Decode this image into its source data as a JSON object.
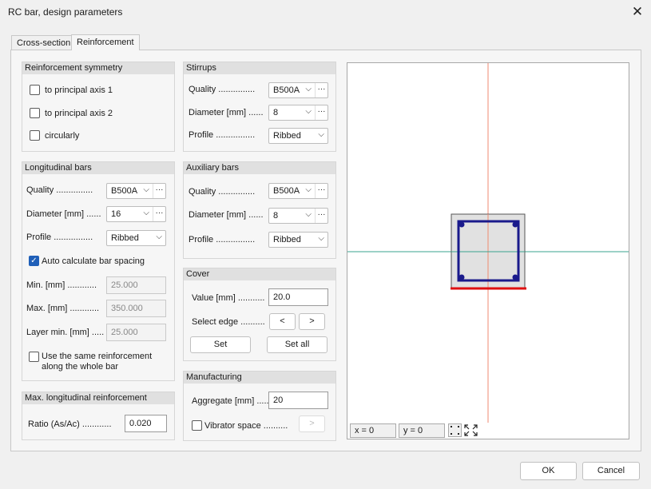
{
  "window": {
    "title": "RC bar, design parameters",
    "close_glyph": "✕"
  },
  "tabs": [
    {
      "label": "Cross-section"
    },
    {
      "label": "Reinforcement"
    }
  ],
  "symmetry": {
    "header": "Reinforcement symmetry",
    "options": [
      {
        "label": "to principal axis 1",
        "checked": false
      },
      {
        "label": "to principal axis 2",
        "checked": false
      },
      {
        "label": "circularly",
        "checked": false
      }
    ]
  },
  "longitudinal": {
    "header": "Longitudinal bars",
    "quality_label": "Quality ...............",
    "quality_value": "B500A",
    "diameter_label": "Diameter [mm] ......",
    "diameter_value": "16",
    "profile_label": "Profile ................",
    "profile_value": "Ribbed",
    "auto_label": "Auto calculate bar spacing",
    "auto_checked": true,
    "min_label": "Min. [mm] ............",
    "min_value": "25.000",
    "max_label": "Max. [mm] ............",
    "max_value": "350.000",
    "layer_label": "Layer min. [mm] .....",
    "layer_value": "25.000",
    "same_label_1": "Use the same reinforcement",
    "same_label_2": "along the whole bar",
    "same_checked": false
  },
  "maxlong": {
    "header": "Max. longitudinal reinforcement",
    "ratio_label": "Ratio (As/Ac) ............",
    "ratio_value": "0.020"
  },
  "stirrups": {
    "header": "Stirrups",
    "quality_label": "Quality ...............",
    "quality_value": "B500A",
    "diameter_label": "Diameter [mm] ......",
    "diameter_value": "8",
    "profile_label": "Profile ................",
    "profile_value": "Ribbed"
  },
  "auxiliary": {
    "header": "Auxiliary bars",
    "quality_label": "Quality ...............",
    "quality_value": "B500A",
    "diameter_label": "Diameter [mm] ......",
    "diameter_value": "8",
    "profile_label": "Profile ................",
    "profile_value": "Ribbed"
  },
  "cover": {
    "header": "Cover",
    "value_label": "Value [mm] ...........",
    "value": "20.0",
    "edge_label": "Select edge ..........",
    "prev": "<",
    "next": ">",
    "set": "Set",
    "set_all": "Set all"
  },
  "manufacturing": {
    "header": "Manufacturing",
    "aggregate_label": "Aggregate [mm] ......",
    "aggregate_value": "20",
    "vibrator_label": "Vibrator space ..........",
    "vibrator_checked": false,
    "vibrator_button": ">"
  },
  "viewer": {
    "x_label": "x = 0",
    "y_label": "y = 0"
  },
  "colors": {
    "stirrup": "#1a1a8c",
    "edge": "#e01010",
    "axis_v": "#ef8a70",
    "axis_h": "#3aa38f",
    "section": "#dcdcdc"
  },
  "icons": {
    "arrow": "chevron-down-icon",
    "dots": "ellipsis-icon",
    "fit": "fit-view-icon",
    "zoom": "zoom-extents-icon"
  },
  "footer": {
    "ok": "OK",
    "cancel": "Cancel"
  }
}
